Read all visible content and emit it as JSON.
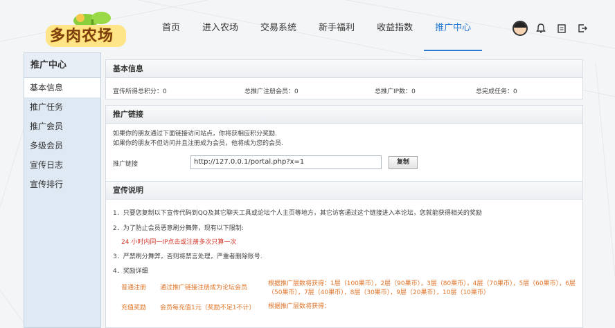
{
  "logo": {
    "text": "多肉农场"
  },
  "nav": {
    "items": [
      {
        "label": "首页"
      },
      {
        "label": "进入农场"
      },
      {
        "label": "交易系统"
      },
      {
        "label": "新手福利"
      },
      {
        "label": "收益指数"
      },
      {
        "label": "推广中心"
      }
    ],
    "active_index": 5
  },
  "user": {
    "icons": [
      "avatar",
      "bell-icon",
      "clipboard-icon",
      "logout-icon"
    ]
  },
  "sidebar": {
    "title": "推广中心",
    "items": [
      {
        "label": "基本信息"
      },
      {
        "label": "推广任务"
      },
      {
        "label": "推广会员"
      },
      {
        "label": "多级会员"
      },
      {
        "label": "宣传日志"
      },
      {
        "label": "宣传排行"
      }
    ],
    "active_index": 0
  },
  "basic_info": {
    "title": "基本信息",
    "stats": [
      {
        "text": "宣传所得总积分：0"
      },
      {
        "text": "总推广注册会员：0"
      },
      {
        "text": "总推广IP数：0"
      },
      {
        "text": "总完成任务：0"
      }
    ]
  },
  "promo_link": {
    "title": "推广链接",
    "note1": "如果你的朋友通过下面链接访问站点，你将获相应积分奖励.",
    "note2": "如果你的朋友不但访问并且注册成为会员，他将成为您的会员.",
    "label": "推广链接",
    "value": "http://127.0.0.1/portal.php?x=1",
    "copy_label": "复制"
  },
  "promo_desc": {
    "title": "宣传说明",
    "rule1": "1．只要您复制以下宣传代码到QQ及其它聊天工具或论坛个人主页等地方，其它访客通过这个链接进入本论坛，您就能获得相关的奖励",
    "rule2": "2．为了防止会员恶意刷分舞弊，现有以下限制:",
    "rule2_limit": "24 小时内同一IP点击或注册多次只算一次",
    "rule3": "3．严禁刷分舞弊，否则将禁言处理，严重者删除账号.",
    "rule4": "4．奖励详细",
    "reward_rows": [
      {
        "type": "普通注册",
        "condition": "通过推广链接注册成为论坛会员",
        "detail": "根据推广层数将获得：1层（100果币），2层（90果币），3层（80果币），4层（70果币），5层（60果币），6层（50果币），7层（40果币），8层（30果币），9层（20果币），10层（10果币）"
      },
      {
        "type": "充值奖励",
        "condition": "会员每充值1元（奖励不足1不计）",
        "detail": "根据推广层数将获得："
      }
    ]
  },
  "colors": {
    "accent": "#2b7bd0",
    "warning": "#d33a2c",
    "orange": "#e07428",
    "sidebar_bg": "#dfe9f3"
  }
}
